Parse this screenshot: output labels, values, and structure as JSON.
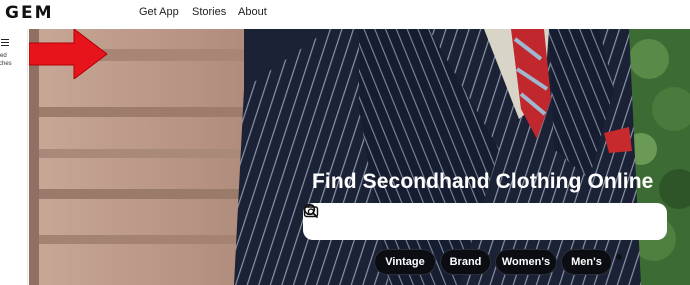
{
  "header": {
    "logo": "GEM",
    "nav": [
      {
        "label": "Get App"
      },
      {
        "label": "Stories"
      },
      {
        "label": "About"
      }
    ]
  },
  "sidebar": {
    "saved_searches_label": "ved\nrches"
  },
  "hero": {
    "title": "Find Secondhand Clothing Online",
    "search": {
      "value": "",
      "placeholder": ""
    },
    "chips": [
      {
        "label": "Vintage"
      },
      {
        "label": "Brand"
      },
      {
        "label": "Women's"
      },
      {
        "label": "Men's"
      }
    ],
    "icons": {
      "search": "search-icon",
      "camera": "camera-icon",
      "annotation": "red-arrow-annotation"
    },
    "colors": {
      "suit": "#1b2236",
      "pinstripe": "#8a93a8",
      "arrow": "#e8141b",
      "chip_bg": "#0b0d12",
      "foliage": "#3d6b34"
    }
  }
}
